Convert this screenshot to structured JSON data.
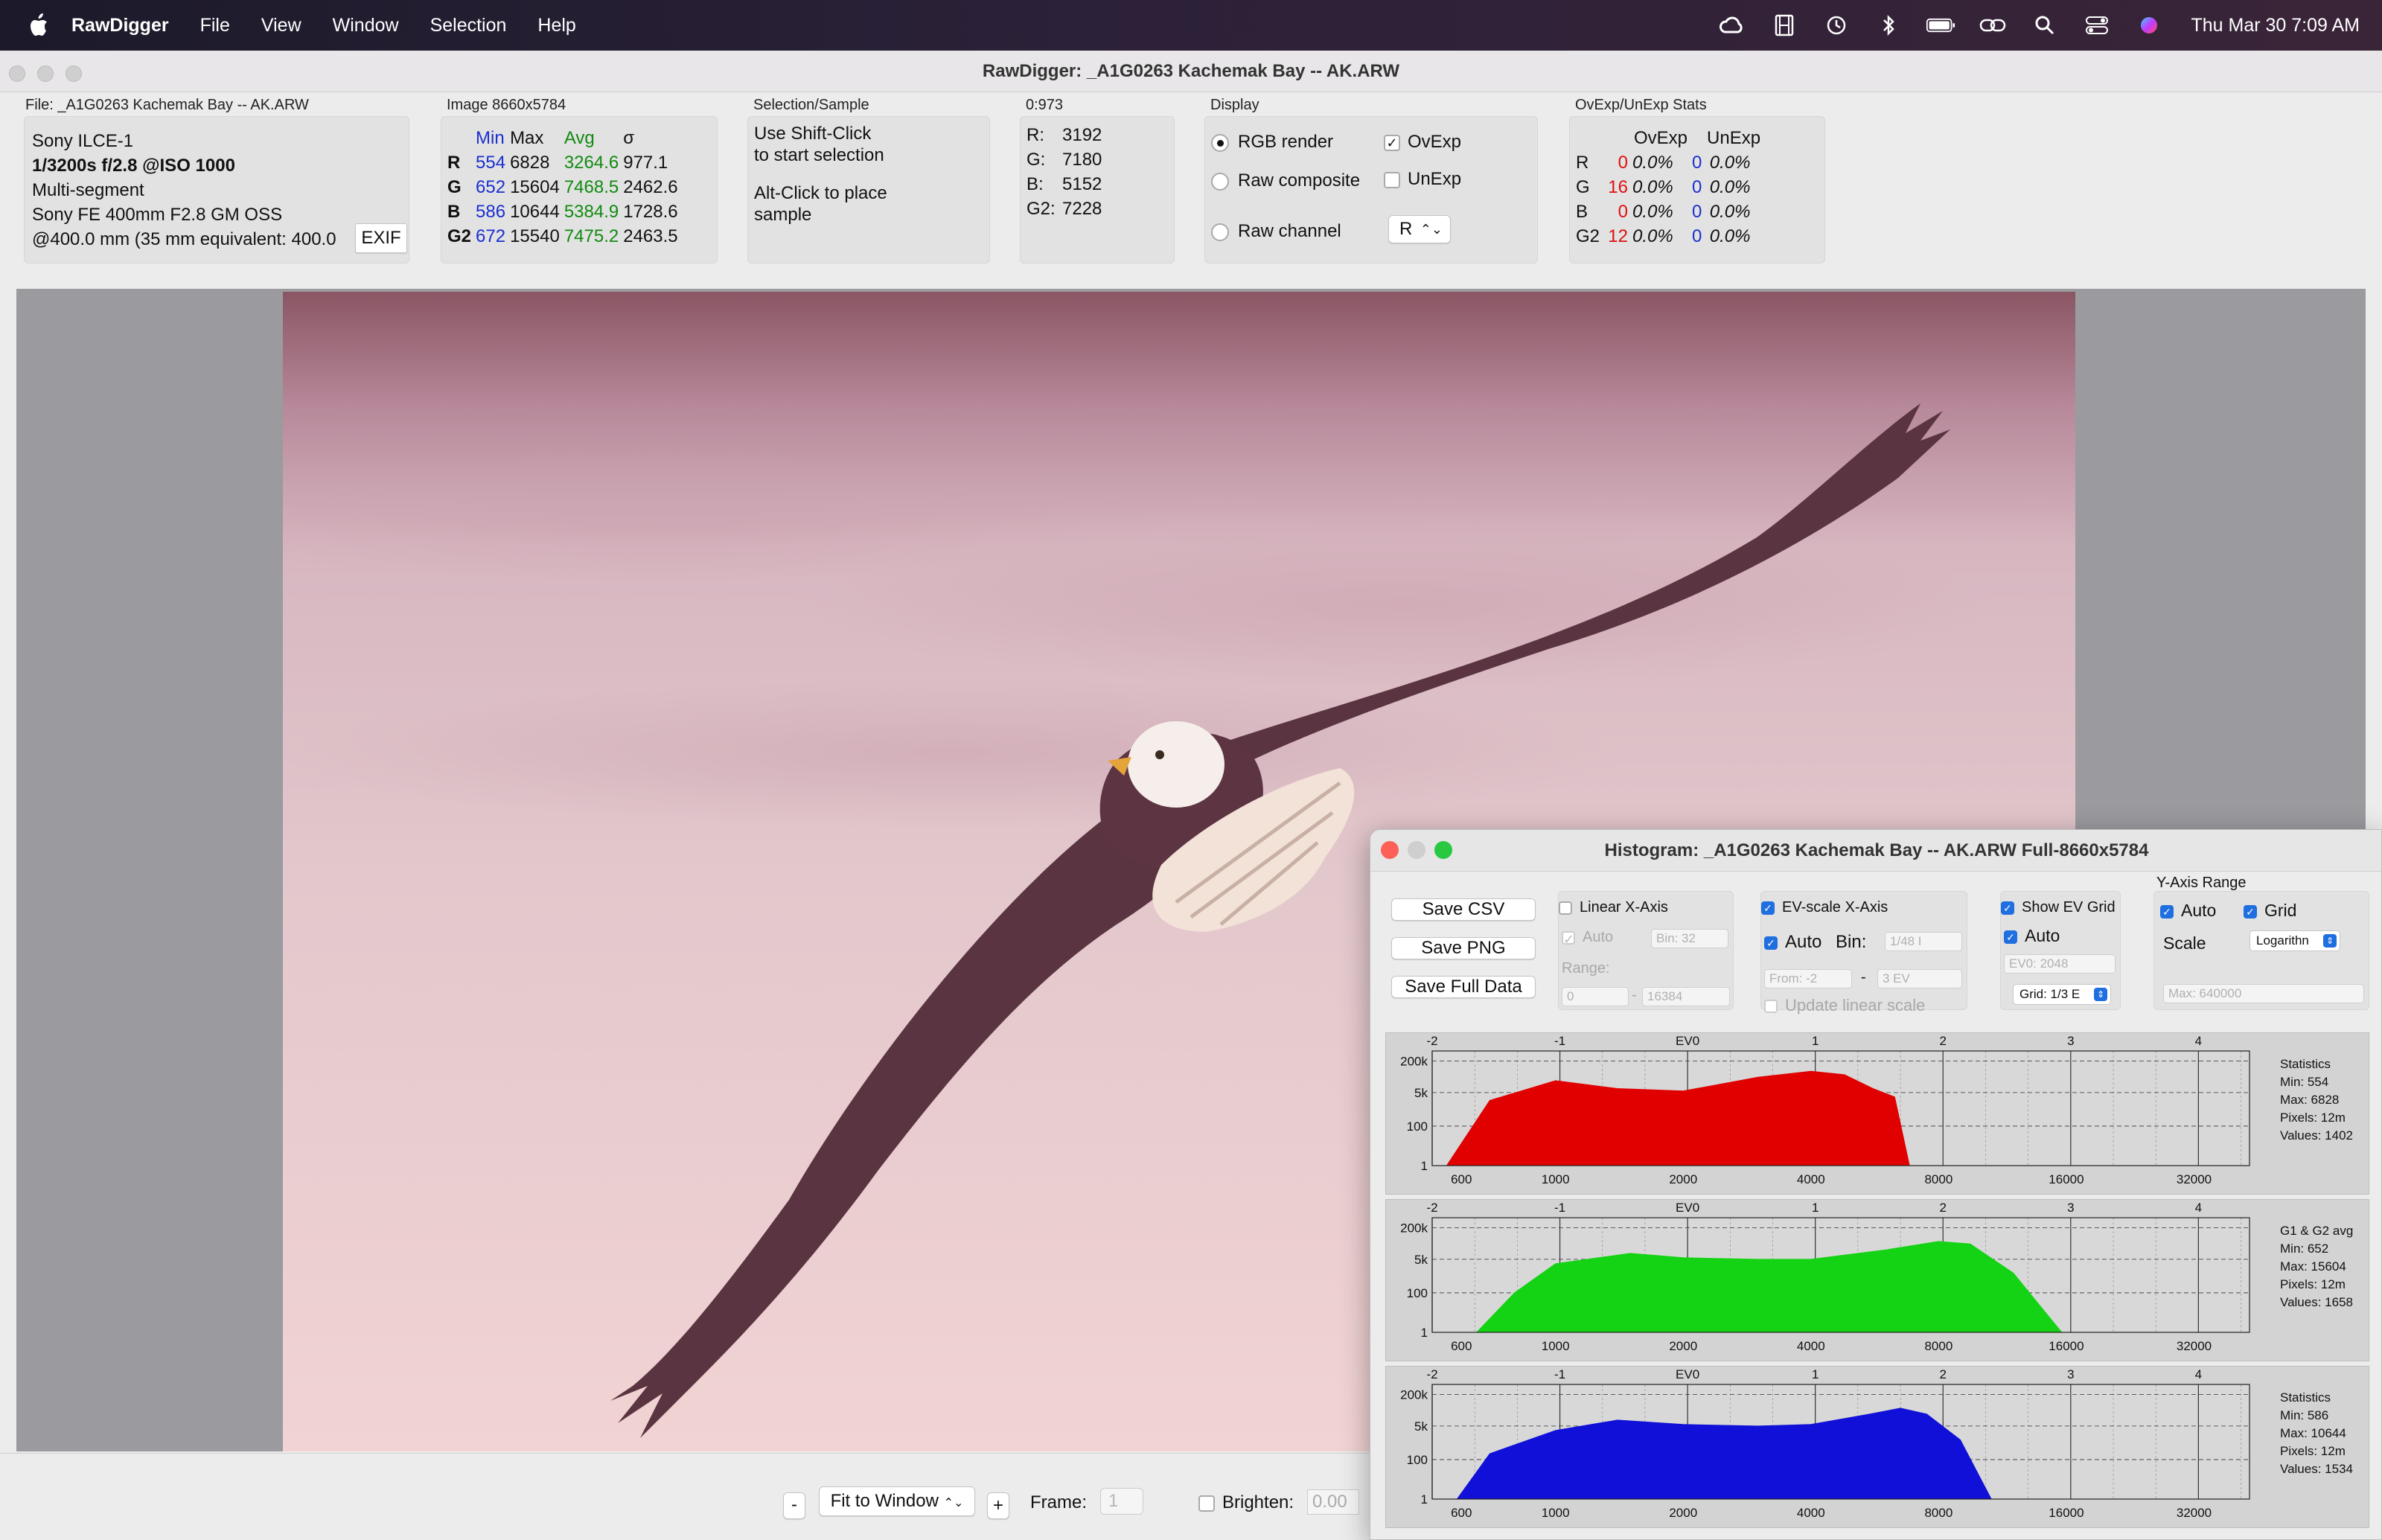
{
  "menubar": {
    "app": "RawDigger",
    "items": [
      "File",
      "View",
      "Window",
      "Selection",
      "Help"
    ],
    "clock": "Thu Mar 30  7:09 AM"
  },
  "window": {
    "title": "RawDigger: _A1G0263  Kachemak Bay -- AK.ARW"
  },
  "file_panel": {
    "label": "File: _A1G0263  Kachemak Bay -- AK.ARW",
    "camera": "Sony ILCE-1",
    "exposure": "1/3200s f/2.8 @ISO 1000",
    "metering": "Multi-segment",
    "lens": "Sony FE 400mm F2.8 GM OSS",
    "focal": "@400.0 mm (35 mm equivalent: 400.0",
    "exif_button": "EXIF"
  },
  "image_panel": {
    "label": "Image 8660x5784",
    "headers": [
      "Min",
      "Max",
      "Avg",
      "σ"
    ],
    "rows": [
      {
        "ch": "R",
        "min": "554",
        "max": "6828",
        "avg": "3264.6",
        "sd": "977.1"
      },
      {
        "ch": "G",
        "min": "652",
        "max": "15604",
        "avg": "7468.5",
        "sd": "2462.6"
      },
      {
        "ch": "B",
        "min": "586",
        "max": "10644",
        "avg": "5384.9",
        "sd": "1728.6"
      },
      {
        "ch": "G2",
        "min": "672",
        "max": "15540",
        "avg": "7475.2",
        "sd": "2463.5"
      }
    ]
  },
  "selection_panel": {
    "label": "Selection/Sample",
    "line1": "Use Shift-Click",
    "line2": "to start selection",
    "line3": "Alt-Click to place",
    "line4": "sample"
  },
  "pixel_panel": {
    "label": "0:973",
    "rows": [
      {
        "ch": "R:",
        "val": "3192"
      },
      {
        "ch": "G:",
        "val": "7180"
      },
      {
        "ch": "B:",
        "val": "5152"
      },
      {
        "ch": "G2:",
        "val": "7228"
      }
    ]
  },
  "display_panel": {
    "label": "Display",
    "rgb_render": "RGB render",
    "raw_composite": "Raw composite",
    "raw_channel": "Raw channel",
    "ovexp": "OvExp",
    "unexp": "UnExp",
    "channel_value": "R"
  },
  "ovexp_panel": {
    "label": "OvExp/UnExp Stats",
    "headers": [
      "OvExp",
      "UnExp"
    ],
    "rows": [
      {
        "ch": "R",
        "ov": "0",
        "ovp": "0.0%",
        "un": "0",
        "unp": "0.0%"
      },
      {
        "ch": "G",
        "ov": "16",
        "ovp": "0.0%",
        "un": "0",
        "unp": "0.0%"
      },
      {
        "ch": "B",
        "ov": "0",
        "ovp": "0.0%",
        "un": "0",
        "unp": "0.0%"
      },
      {
        "ch": "G2",
        "ov": "12",
        "ovp": "0.0%",
        "un": "0",
        "unp": "0.0%"
      }
    ]
  },
  "bottombar": {
    "minus": "-",
    "fit": "Fit to Window",
    "plus": "+",
    "frame_label": "Frame:",
    "frame_value": "1",
    "brighten_label": "Brighten:",
    "brighten_value": "0.00"
  },
  "histogram": {
    "title": "Histogram: _A1G0263  Kachemak Bay -- AK.ARW Full-8660x5784",
    "save_csv": "Save CSV",
    "save_png": "Save PNG",
    "save_full": "Save Full Data",
    "linear_x": "Linear X-Axis",
    "auto": "Auto",
    "bin_field": "Bin: 32",
    "range": "Range:",
    "range_from": "0",
    "range_to": "16384",
    "ev_scale": "EV-scale X-Axis",
    "ev_auto": "Auto",
    "ev_bin": "Bin:",
    "ev_bin_field": "1/48 I",
    "ev_from": "From: -2",
    "ev_to": "3 EV",
    "update_linear": "Update linear scale",
    "show_ev_grid": "Show EV Grid",
    "grid_auto": "Auto",
    "ev0_field": "EV0: 2048",
    "grid_popup": "Grid: 1/3 E",
    "y_range": "Y-Axis Range",
    "y_auto": "Auto",
    "y_grid": "Grid",
    "scale_label": "Scale",
    "scale_popup": "Logarithn",
    "max_field": "Max: 640000",
    "top_ticks": [
      "-2",
      "-1",
      "EV0",
      "1",
      "2",
      "3",
      "4"
    ],
    "bottom_ticks": [
      "600",
      "1000",
      "2000",
      "4000",
      "8000",
      "16000",
      "32000"
    ],
    "y_ticks": [
      "200k",
      "5k",
      "100",
      "1"
    ],
    "channels": [
      {
        "color": "#e00000",
        "stats_title": "Statistics",
        "min": "Min: 554",
        "max": "Max: 6828",
        "pixels": "Pixels: 12m",
        "values": "Values: 1402"
      },
      {
        "color": "#14d214",
        "stats_title": "G1 & G2 avg",
        "min": "Min: 652",
        "max": "Max: 15604",
        "pixels": "Pixels: 12m",
        "values": "Values: 1658"
      },
      {
        "color": "#1010d8",
        "stats_title": "Statistics",
        "min": "Min: 586",
        "max": "Max: 10644",
        "pixels": "Pixels: 12m",
        "values": "Values: 1534"
      }
    ]
  },
  "chart_data": [
    {
      "type": "area",
      "title": "",
      "x": [
        554,
        700,
        1000,
        1400,
        2000,
        3000,
        4000,
        4800,
        5600,
        6300,
        6828
      ],
      "values": [
        1,
        2000,
        20000,
        8000,
        6000,
        30000,
        60000,
        40000,
        8000,
        3000,
        1
      ],
      "xlabel": "",
      "ylabel": "",
      "ylim": [
        1,
        640000
      ],
      "xscale": "log2",
      "color": "#e00000"
    },
    {
      "type": "area",
      "title": "",
      "x": [
        652,
        800,
        1000,
        1500,
        2000,
        3000,
        4000,
        6000,
        8000,
        9500,
        12000,
        15604
      ],
      "values": [
        1,
        100,
        3000,
        10000,
        6000,
        5000,
        5000,
        15000,
        40000,
        30000,
        1000,
        1
      ],
      "xlabel": "",
      "ylabel": "",
      "ylim": [
        1,
        640000
      ],
      "xscale": "log2",
      "color": "#14d214"
    },
    {
      "type": "area",
      "title": "",
      "x": [
        586,
        700,
        1000,
        1400,
        2000,
        3000,
        4000,
        5500,
        6500,
        7500,
        9000,
        10644
      ],
      "values": [
        1,
        200,
        3000,
        10000,
        6000,
        5000,
        6000,
        20000,
        40000,
        20000,
        1000,
        1
      ],
      "xlabel": "",
      "ylabel": "",
      "ylim": [
        1,
        640000
      ],
      "xscale": "log2",
      "color": "#1010d8"
    }
  ]
}
